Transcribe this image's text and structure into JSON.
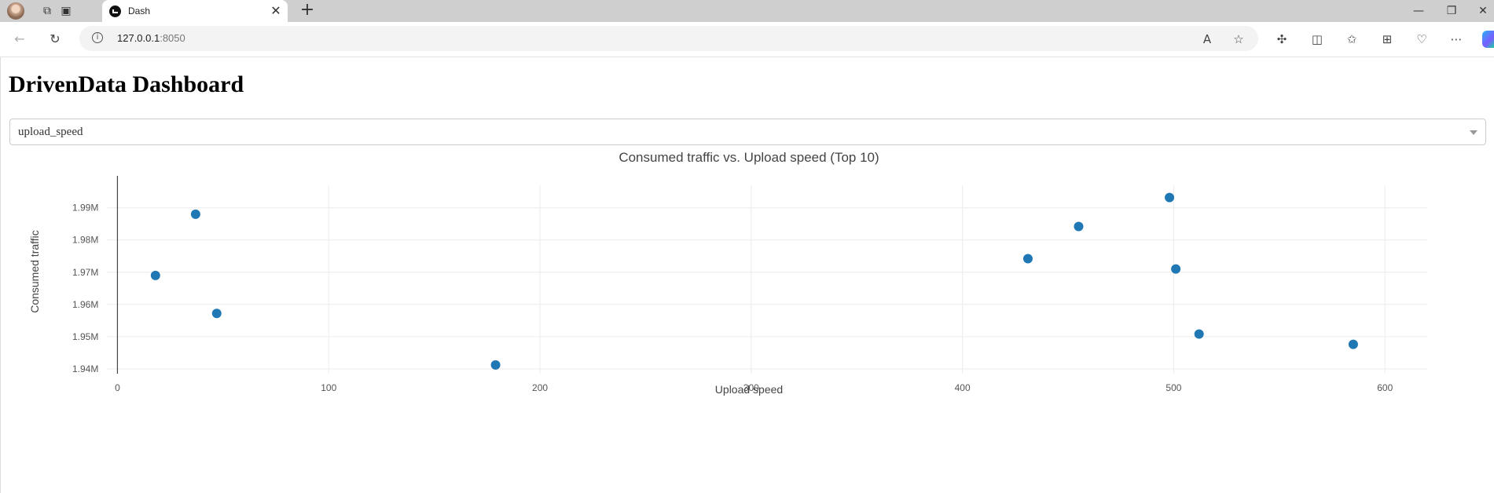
{
  "browser": {
    "tab_title": "Dash",
    "url_host": "127.0.0.1",
    "url_port": ":8050"
  },
  "page": {
    "title": "DrivenData Dashboard",
    "dropdown_value": "upload_speed"
  },
  "chart_data": {
    "type": "scatter",
    "title": "Consumed traffic vs. Upload speed (Top 10)",
    "xlabel": "Upload speed",
    "ylabel": "Consumed traffic",
    "xlim": [
      -5,
      620
    ],
    "ylim": [
      1.9385,
      1.997
    ],
    "x_ticks": [
      0,
      100,
      200,
      300,
      400,
      500,
      600
    ],
    "x_tick_labels": [
      "0",
      "100",
      "200",
      "300",
      "400",
      "500",
      "600"
    ],
    "y_ticks": [
      1.94,
      1.95,
      1.96,
      1.97,
      1.98,
      1.99
    ],
    "y_tick_labels": [
      "1.94M",
      "1.95M",
      "1.96M",
      "1.97M",
      "1.98M",
      "1.99M"
    ],
    "grid": true,
    "marker_color": "#1f77b4",
    "x": [
      18,
      37,
      47,
      179,
      431,
      455,
      498,
      501,
      512,
      585
    ],
    "y": [
      1.969,
      1.988,
      1.9572,
      1.9412,
      1.9742,
      1.9842,
      1.9932,
      1.971,
      1.9508,
      1.9476
    ]
  }
}
